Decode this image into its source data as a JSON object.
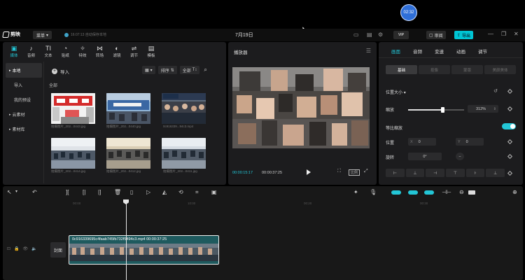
{
  "overlay": {
    "clock": "02:32"
  },
  "titlebar": {
    "app_name": "剪映",
    "menu_label": "菜单",
    "autosave": "16:07:13 自动保存本地",
    "project_title": "7月19日",
    "vip": "VIP",
    "review": "审阅",
    "export": "导出"
  },
  "media": {
    "tabs": [
      {
        "icon": "▣",
        "label": "媒体",
        "active": true
      },
      {
        "icon": "♪",
        "label": "音频"
      },
      {
        "icon": "TI",
        "label": "文本"
      },
      {
        "icon": "◔",
        "label": "贴纸"
      },
      {
        "icon": "✧",
        "label": "特效"
      },
      {
        "icon": "⋈",
        "label": "转场"
      },
      {
        "icon": "◐",
        "label": "滤镜"
      },
      {
        "icon": "⇌",
        "label": "调节"
      },
      {
        "icon": "▤",
        "label": "模板"
      }
    ],
    "sidebar": [
      {
        "label": "本地",
        "active": true,
        "prefix": "▸"
      },
      {
        "label": "导入"
      },
      {
        "label": "我的预设"
      },
      {
        "label": "云素材",
        "prefix": "▸"
      },
      {
        "label": "素材库",
        "prefix": "▸"
      }
    ],
    "import_label": "导入",
    "sort_label": "排序",
    "filter_label": "全部",
    "all_label": "全部",
    "thumbnails": [
      {
        "caption": "拍摄图片_202...0443.jpg"
      },
      {
        "caption": "拍摄图片_202...0440.jpg"
      },
      {
        "caption": "0c916339...94c3.mp4"
      },
      {
        "caption": "拍摄图片_202...0414.jpg"
      },
      {
        "caption": "拍摄图片_202...0412.jpg"
      },
      {
        "caption": "拍摄图片_202...0411.jpg"
      }
    ]
  },
  "player": {
    "title": "播放器",
    "time_current": "00:00:15:17",
    "time_total": "00:00:37:25",
    "ratio_label": "比例"
  },
  "props": {
    "tabs": [
      {
        "label": "画面",
        "active": true
      },
      {
        "label": "音频"
      },
      {
        "label": "变速"
      },
      {
        "label": "动画"
      },
      {
        "label": "调节"
      }
    ],
    "subtabs": [
      {
        "label": "基础",
        "active": true
      },
      {
        "label": "抠像"
      },
      {
        "label": "蒙版"
      },
      {
        "label": "美颜美体"
      }
    ],
    "section_title": "位置大小",
    "scale_label": "缩放",
    "scale_value": "312%",
    "scale_fraction": 0.62,
    "uniform_label": "等比缩放",
    "position_label": "位置",
    "pos_x_axis": "X",
    "pos_x": "0",
    "pos_y_axis": "Y",
    "pos_y": "0",
    "rotate_label": "旋转",
    "rotate_value": "0°"
  },
  "timeline": {
    "ruler": [
      "00:00",
      "10:00",
      "00:20",
      "00:30"
    ],
    "cover_label": "封面",
    "clip_label": "0c916339695c4faab745fb732f5494c3.mp4   00:00:37:25"
  }
}
